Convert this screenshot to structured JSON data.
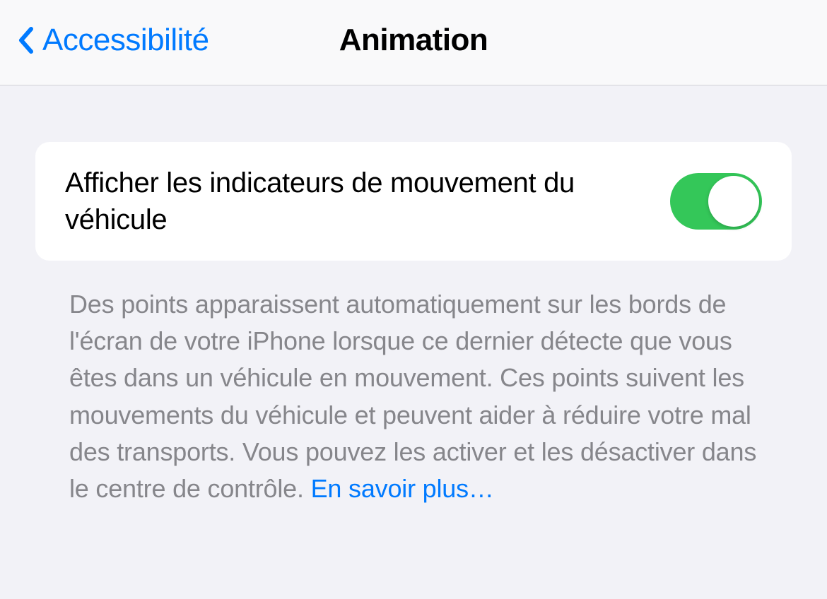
{
  "header": {
    "back_label": "Accessibilité",
    "title": "Animation"
  },
  "setting": {
    "label": "Afficher les indicateurs de mouvement du véhicule",
    "toggle_on": true
  },
  "description": {
    "text": "Des points apparaissent automatiquement sur les bords de l'écran de votre iPhone lorsque ce dernier détecte que vous êtes dans un véhicule en mouvement. Ces points suivent les mouvements du véhicule et peuvent aider à réduire votre mal des transports. Vous pouvez les activer et les désactiver dans le centre de contrôle. ",
    "learn_more": "En savoir plus…"
  },
  "colors": {
    "accent": "#007aff",
    "toggle_on": "#34c759",
    "background": "#f2f2f7",
    "card": "#ffffff",
    "text_secondary": "#86868b"
  }
}
